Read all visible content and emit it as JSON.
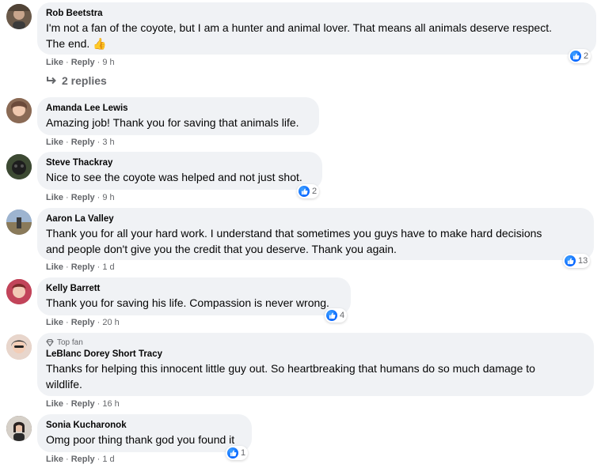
{
  "comments": [
    {
      "author": "Rob Beetstra",
      "text_line1": "I'm not a fan of the coyote, but I am a hunter and animal lover. That means all animals deserve respect.",
      "text_line2": "The end. 👍",
      "like": "Like",
      "reply": "Reply",
      "time": "9 h",
      "reactions": "2",
      "replies": "2 replies",
      "avatar_color": "#6b5a4a"
    },
    {
      "author": "Amanda Lee Lewis",
      "text_line1": "Amazing job! Thank you for saving that animals life.",
      "like": "Like",
      "reply": "Reply",
      "time": "3 h",
      "avatar_color": "#c89f86"
    },
    {
      "author": "Steve Thackray",
      "text_line1": "Nice to see the coyote was helped and not just shot.",
      "like": "Like",
      "reply": "Reply",
      "time": "9 h",
      "reactions": "2",
      "avatar_color": "#2f3a2b"
    },
    {
      "author": "Aaron La Valley",
      "text_line1": "Thank you for all your hard work. I understand that sometimes you guys have to make hard decisions",
      "text_line2": "and people don't give you the credit that you deserve. Thank you again.",
      "like": "Like",
      "reply": "Reply",
      "time": "1 d",
      "reactions": "13",
      "avatar_color": "#7d95b3"
    },
    {
      "author": "Kelly Barrett",
      "text_line1": "Thank you for saving his life. Compassion is never wrong.",
      "like": "Like",
      "reply": "Reply",
      "time": "20 h",
      "reactions": "4",
      "avatar_color": "#b83a4b"
    },
    {
      "top_fan": "Top fan",
      "author": "LeBlanc Dorey Short Tracy",
      "text_line1": "Thanks for helping this innocent little guy out. So heartbreaking that humans do so much damage to",
      "text_line2": "wildlife.",
      "like": "Like",
      "reply": "Reply",
      "time": "16 h",
      "avatar_color": "#d9b9a6"
    },
    {
      "author": "Sonia Kucharonok",
      "text_line1": "Omg poor thing thank god you found it",
      "like": "Like",
      "reply": "Reply",
      "time": "1 d",
      "reactions": "1",
      "avatar_color": "#4a3f3a"
    }
  ],
  "colors": {
    "bubble": "#f0f2f5",
    "meta_text": "#65676b",
    "like_blue": "#0866ff"
  },
  "icons": {
    "like_reaction": "thumbs-up-icon",
    "reply_arrow": "reply-arrow-icon",
    "top_fan_badge": "diamond-icon"
  }
}
